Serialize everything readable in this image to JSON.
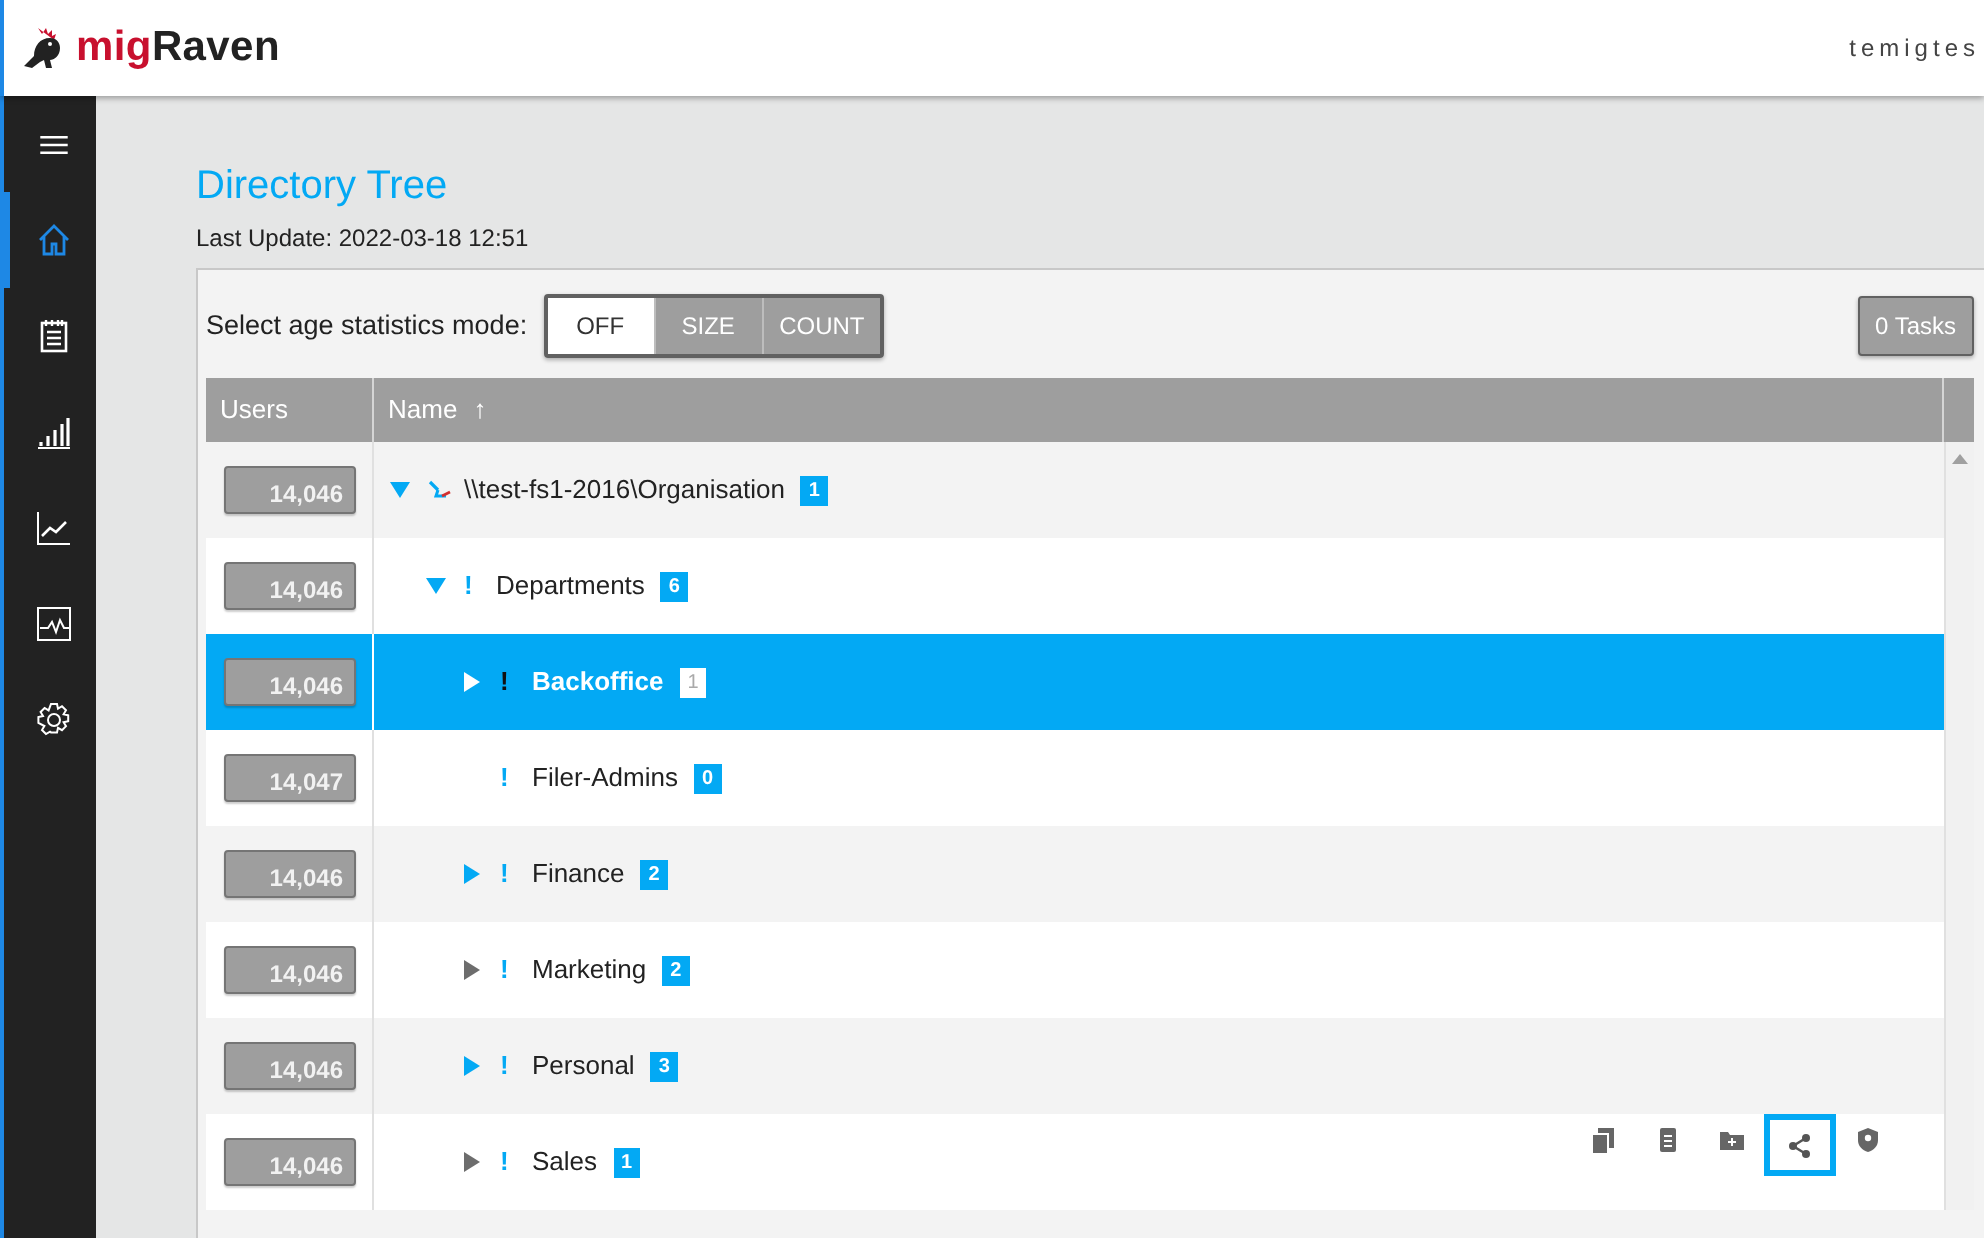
{
  "header": {
    "logo_text": "migRaven",
    "user": "temigtes"
  },
  "sidebar": {
    "items": [
      {
        "kind": "home",
        "selected": true
      },
      {
        "kind": "clipboard",
        "selected": false
      },
      {
        "kind": "bars",
        "selected": false
      },
      {
        "kind": "trend",
        "selected": false
      },
      {
        "kind": "monitor",
        "selected": false
      },
      {
        "kind": "gear",
        "selected": false
      }
    ]
  },
  "page": {
    "title": "Directory Tree",
    "subtitle": "Last Update: 2022-03-18 12:51"
  },
  "toolbar": {
    "mode_label": "Select age statistics mode:",
    "modes": [
      {
        "label": "OFF",
        "selected": true
      },
      {
        "label": "SIZE",
        "selected": false
      },
      {
        "label": "COUNT",
        "selected": false
      }
    ],
    "tasks_button": "0 Tasks"
  },
  "table": {
    "columns": [
      {
        "label": "Users"
      },
      {
        "label": "Name",
        "sort_icon": "↑"
      }
    ],
    "tree": [
      {
        "users": "14,046",
        "name": "\\\\test-fs1-2016\\Organisation",
        "count": "1",
        "kind": "share",
        "expanded": true,
        "selected": false,
        "color": "#03a9f4",
        "children": [
          {
            "users": "14,046",
            "name": "Departments",
            "count": "6",
            "kind": "flag",
            "flag": "!",
            "expanded": true,
            "selected": false,
            "color": "#03a9f4",
            "children": [
              {
                "users": "14,046",
                "name": "Backoffice",
                "count": "1",
                "kind": "flag",
                "flag": "!",
                "expanded": false,
                "selected": true,
                "color": "#ffffff"
              },
              {
                "users": "14,047",
                "name": "Filer-Admins",
                "count": "0",
                "kind": "flag",
                "flag": "!",
                "selected": false
              },
              {
                "users": "14,046",
                "name": "Finance",
                "count": "2",
                "kind": "flag",
                "flag": "!",
                "expanded": false,
                "selected": false,
                "color": "#03a9f4"
              },
              {
                "users": "14,046",
                "name": "Marketing",
                "count": "2",
                "kind": "flag",
                "flag": "!",
                "expanded": false,
                "selected": false,
                "color": "#6d6d6d"
              },
              {
                "users": "14,046",
                "name": "Personal",
                "count": "3",
                "kind": "flag",
                "flag": "!",
                "expanded": false,
                "selected": false,
                "color": "#03a9f4"
              },
              {
                "users": "14,046",
                "name": "Sales",
                "count": "1",
                "kind": "flag",
                "flag": "!",
                "expanded": false,
                "selected": false,
                "color": "#6d6d6d",
                "actions": [
                  {
                    "kind": "copy",
                    "selected": false
                  },
                  {
                    "kind": "document",
                    "selected": false
                  },
                  {
                    "kind": "folder-add",
                    "selected": false
                  },
                  {
                    "kind": "share",
                    "selected": true
                  },
                  {
                    "kind": "shield",
                    "selected": false
                  }
                ]
              }
            ]
          }
        ]
      }
    ]
  }
}
